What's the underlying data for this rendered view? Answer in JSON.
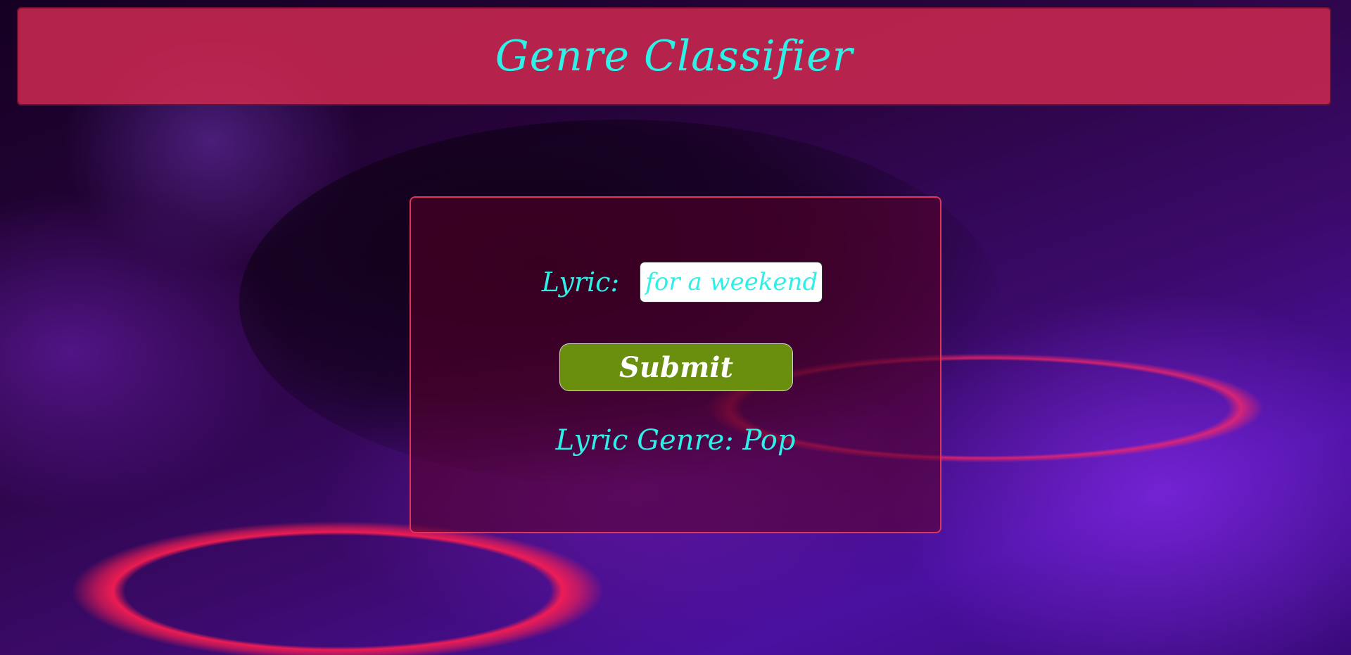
{
  "header": {
    "title": "Genre Classifier"
  },
  "form": {
    "lyric_label": "Lyric:",
    "lyric_value": "l for a weekend",
    "submit_label": "Submit"
  },
  "result": {
    "text": "Lyric Genre: Pop"
  },
  "colors": {
    "accent_text": "#2ef0e6",
    "header_bg": "#c92850",
    "panel_border": "#e0345a",
    "submit_bg": "#6a8f0e"
  }
}
